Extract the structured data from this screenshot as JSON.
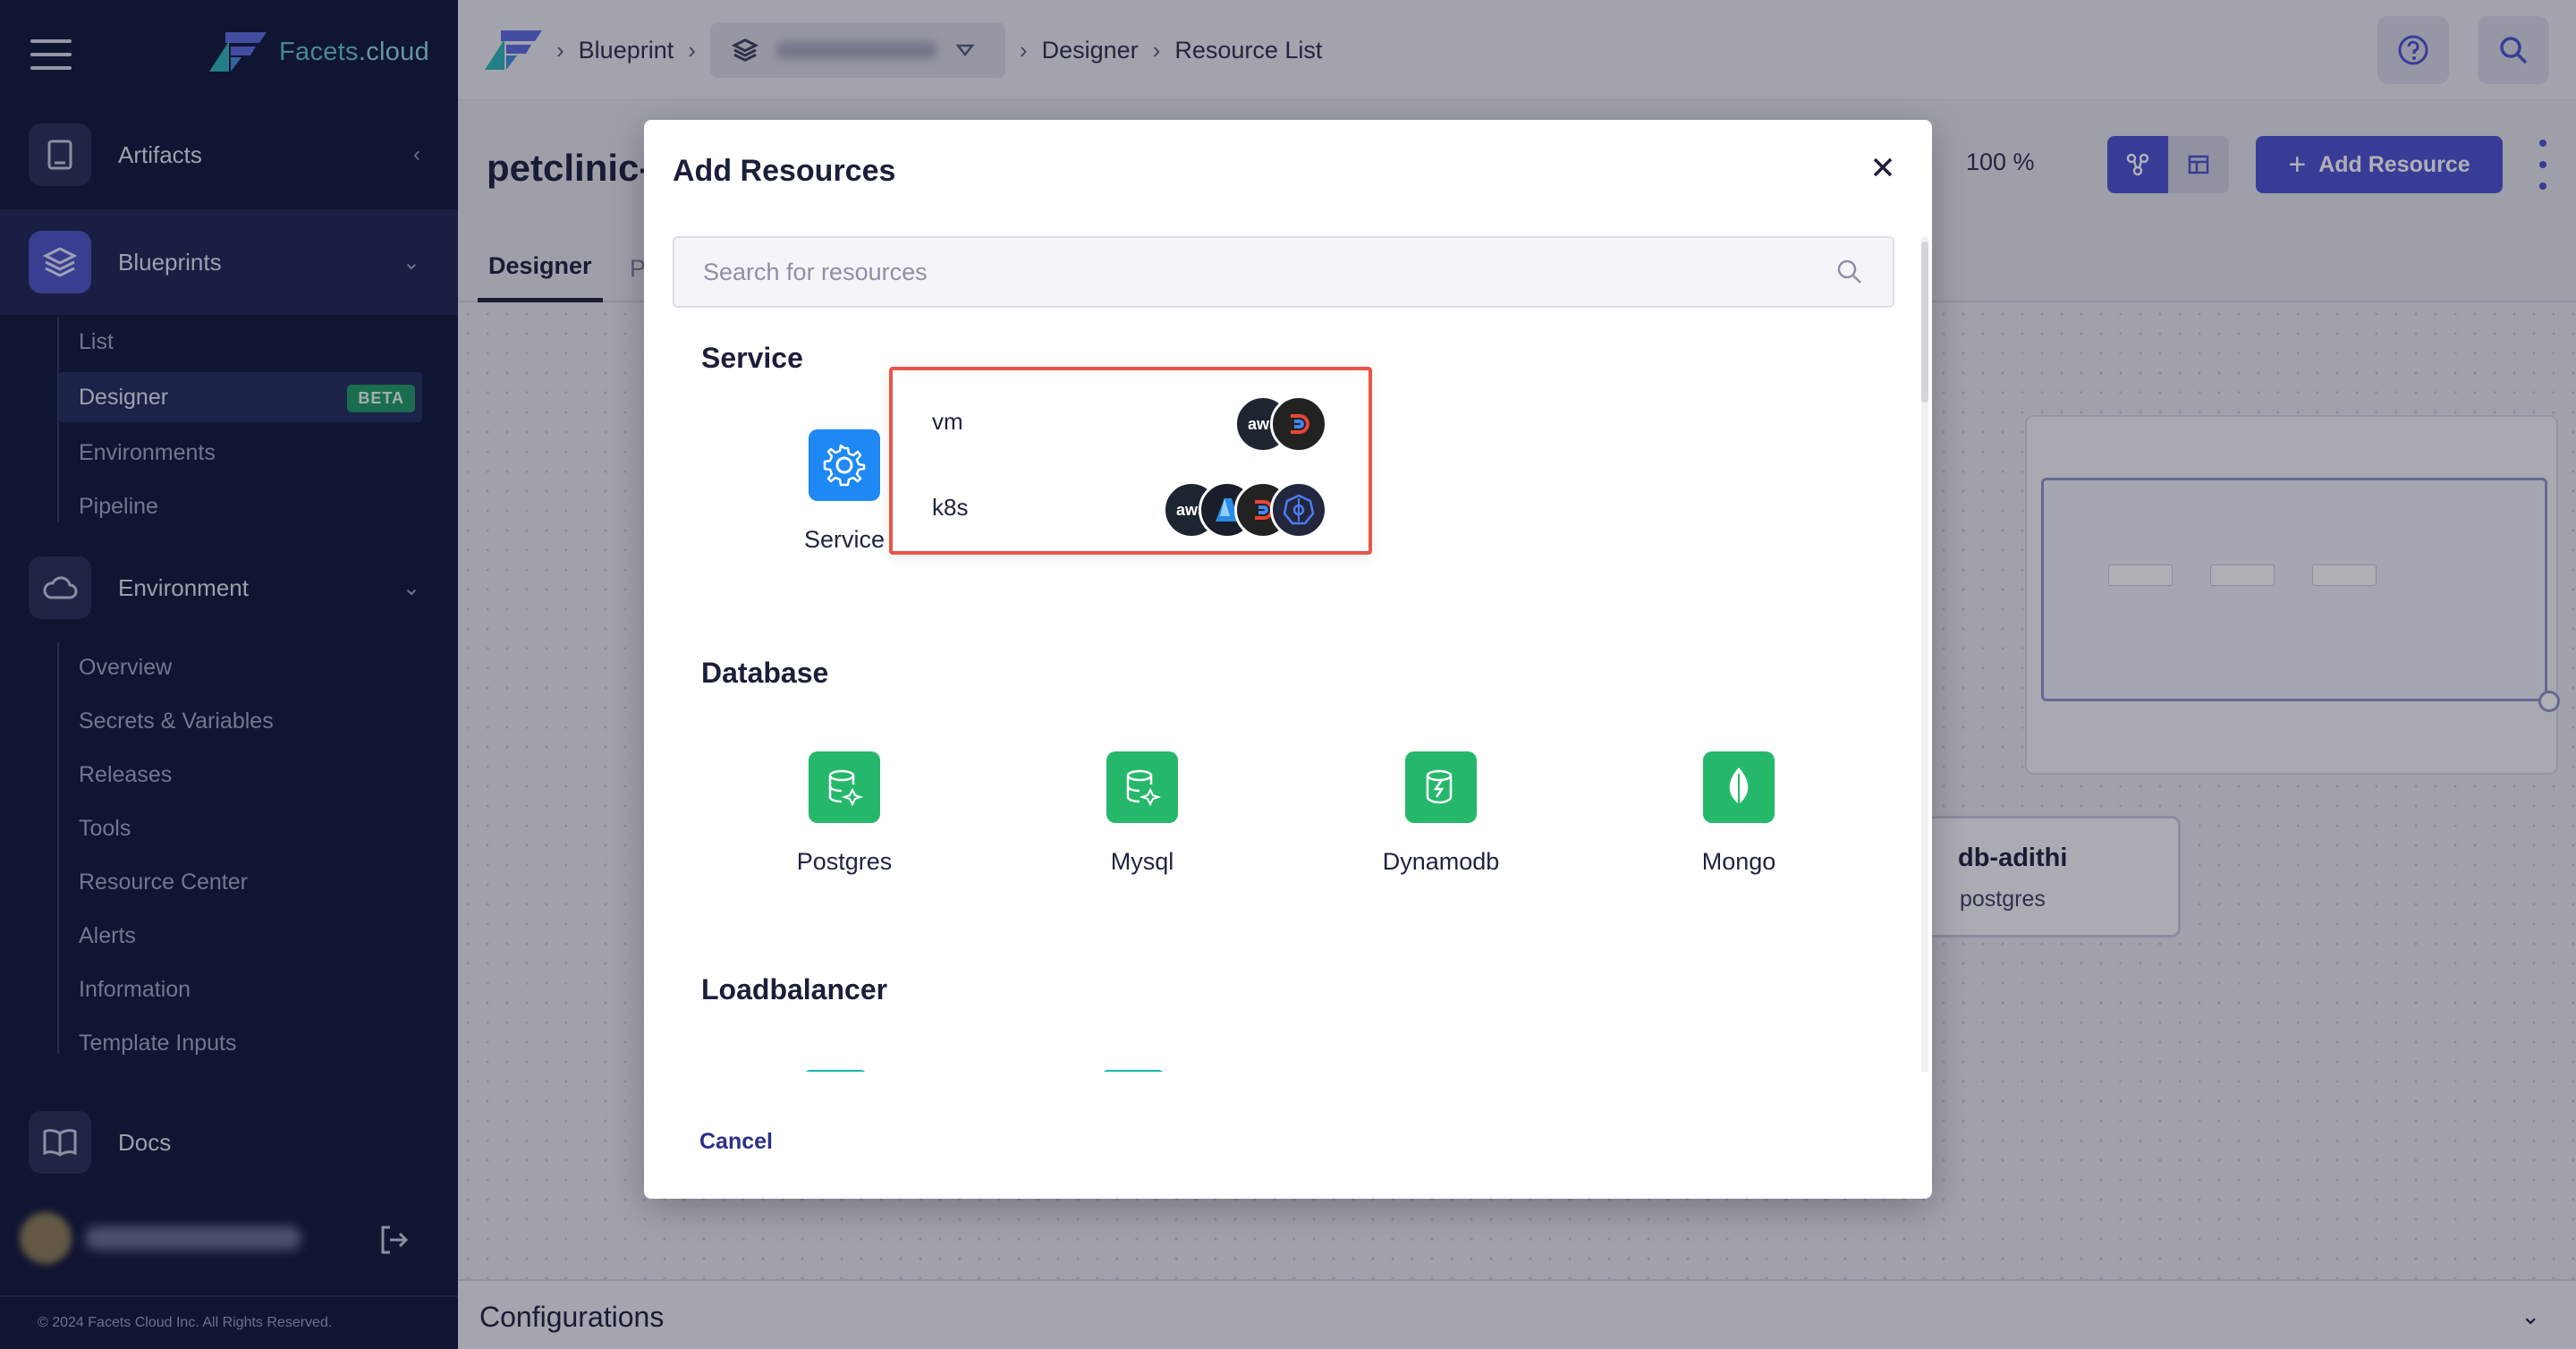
{
  "sidebar": {
    "brand": "Facets",
    "brand_suffix": ".cloud",
    "artifacts": "Artifacts",
    "blueprints": "Blueprints",
    "blueprint_items": [
      "List",
      "Designer",
      "Environments",
      "Pipeline"
    ],
    "beta_badge": "BETA",
    "environment": "Environment",
    "environment_items": [
      "Overview",
      "Secrets & Variables",
      "Releases",
      "Tools",
      "Resource Center",
      "Alerts",
      "Information",
      "Template Inputs"
    ],
    "docs": "Docs",
    "copyright": "© 2024 Facets Cloud Inc. All Rights Reserved."
  },
  "breadcrumb": {
    "blueprint": "Blueprint",
    "designer": "Designer",
    "resource_list": "Resource List"
  },
  "page": {
    "title": "petclinic-",
    "tabs": [
      "Designer",
      "Pu"
    ],
    "zoom": "100 %",
    "add_resource": "Add Resource",
    "db_node_name": "db-adithi",
    "db_node_type": "postgres",
    "configurations": "Configurations"
  },
  "modal": {
    "title": "Add Resources",
    "search_placeholder": "Search for resources",
    "sections": {
      "service": "Service",
      "database": "Database",
      "loadbalancer": "Loadbalancer"
    },
    "service_tile": "Service",
    "variants": [
      {
        "name": "vm",
        "providers": [
          "aws",
          "gcp"
        ]
      },
      {
        "name": "k8s",
        "providers": [
          "aws",
          "azure",
          "gcp",
          "kubernetes"
        ]
      }
    ],
    "database_tiles": [
      "Postgres",
      "Mysql",
      "Dynamodb",
      "Mongo"
    ],
    "cancel": "Cancel"
  },
  "colors": {
    "sidebar_bg": "#0f1437",
    "accent": "#4c4fd0",
    "service_blue": "#1e88f5",
    "db_green": "#26b86a",
    "highlight_red": "#e8554a"
  }
}
